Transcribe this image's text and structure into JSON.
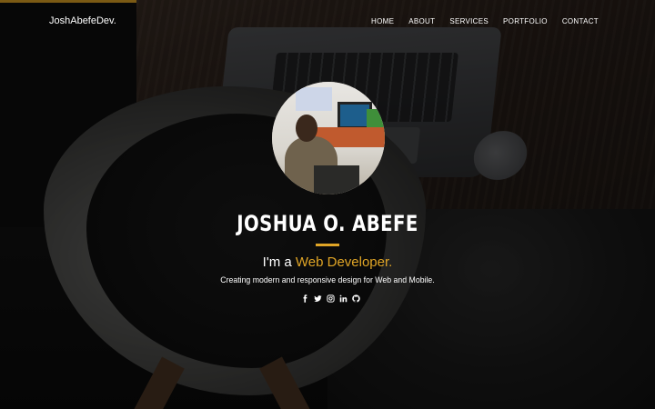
{
  "nav": {
    "brand": "JoshAbefeDev.",
    "items": [
      {
        "label": "HOME"
      },
      {
        "label": "ABOUT"
      },
      {
        "label": "SERVICES"
      },
      {
        "label": "PORTFOLIO"
      },
      {
        "label": "CONTACT"
      }
    ]
  },
  "hero": {
    "name": "JOSHUA O. ABEFE",
    "role_prefix": "I'm a ",
    "role_highlight": "Web Developer.",
    "tagline": "Creating modern and responsive design for Web and Mobile."
  },
  "social": [
    {
      "icon": "facebook-icon"
    },
    {
      "icon": "twitter-icon"
    },
    {
      "icon": "instagram-icon"
    },
    {
      "icon": "linkedin-icon"
    },
    {
      "icon": "github-icon"
    }
  ],
  "colors": {
    "accent": "#e0a526",
    "text": "#ffffff"
  }
}
